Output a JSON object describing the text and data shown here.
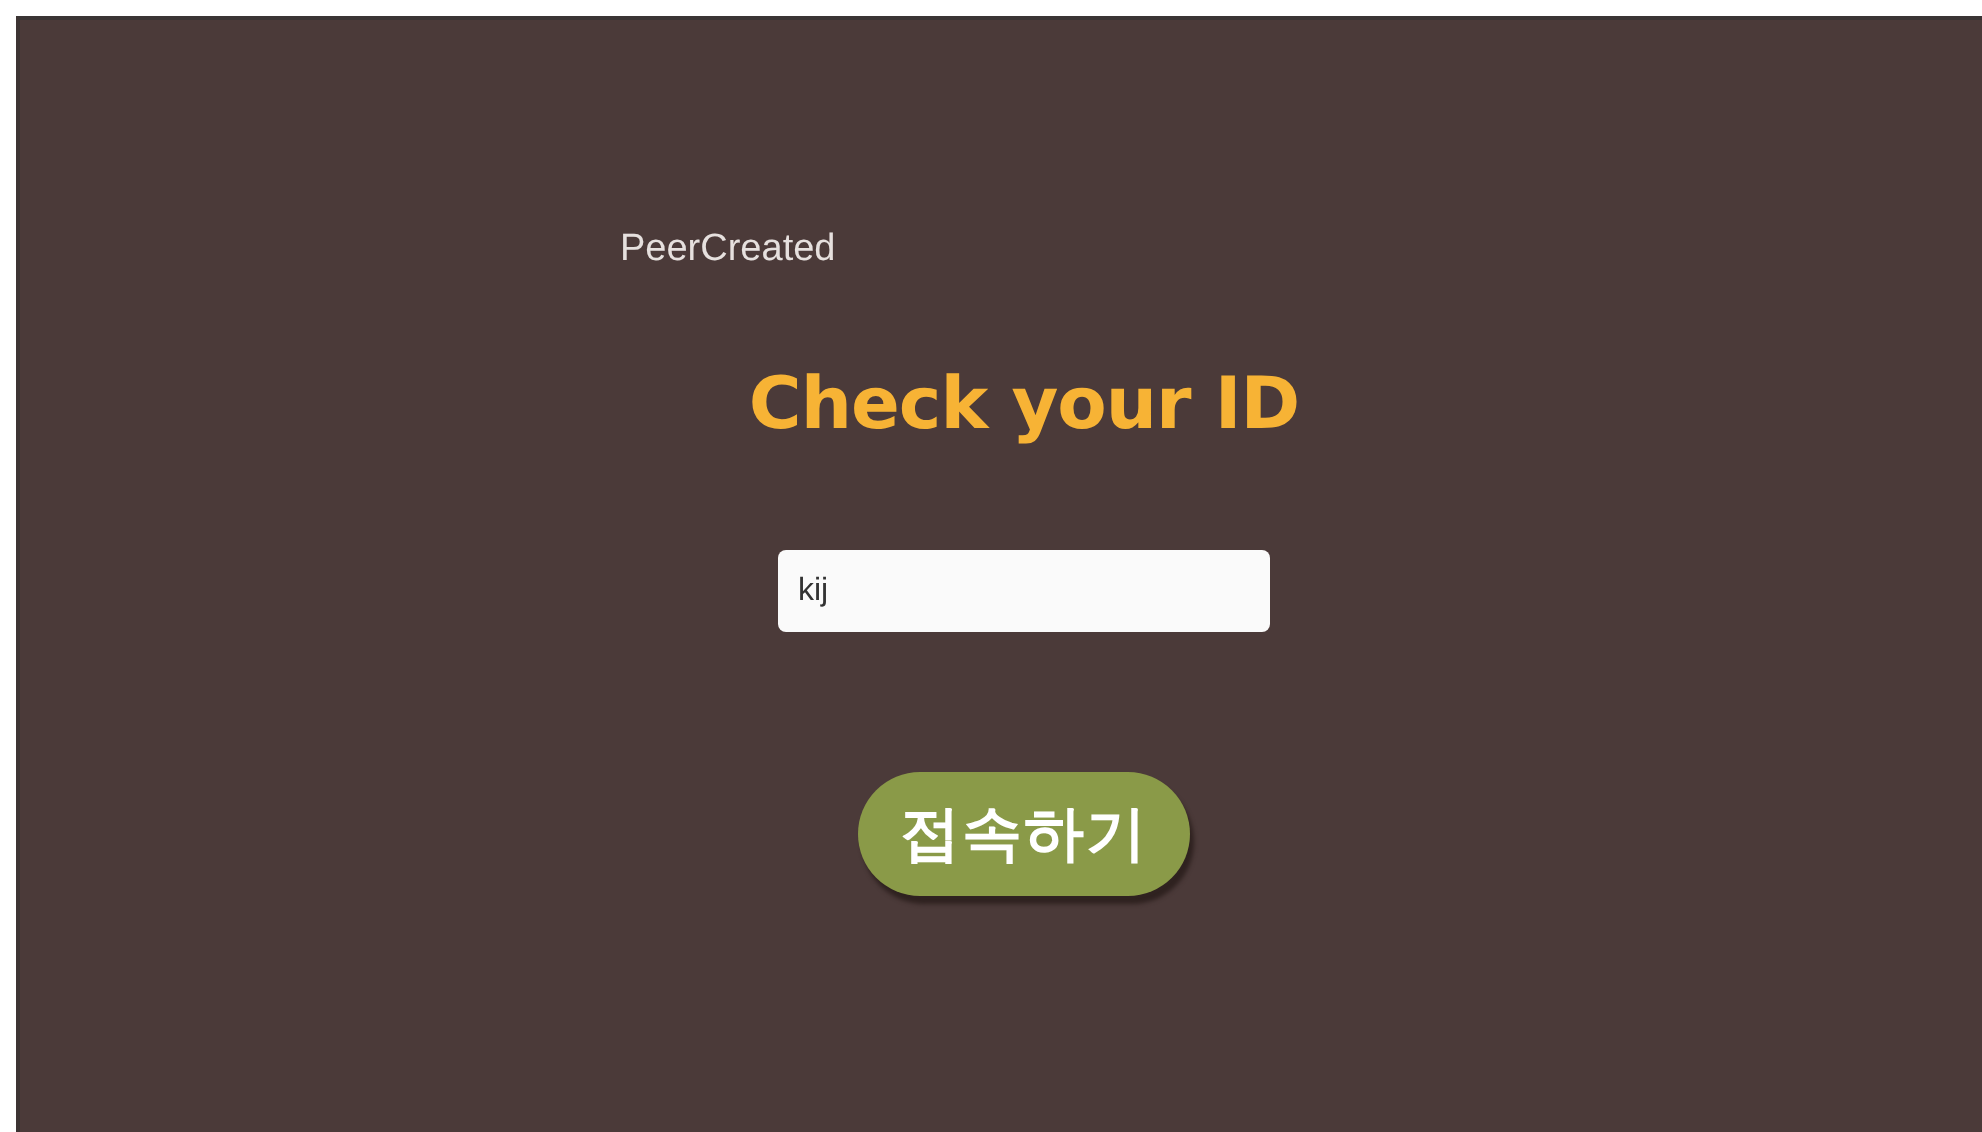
{
  "status_text": "PeerCreated",
  "title": "Check your ID",
  "id_field": {
    "value": "kij"
  },
  "connect_button": {
    "label": "접속하기"
  }
}
